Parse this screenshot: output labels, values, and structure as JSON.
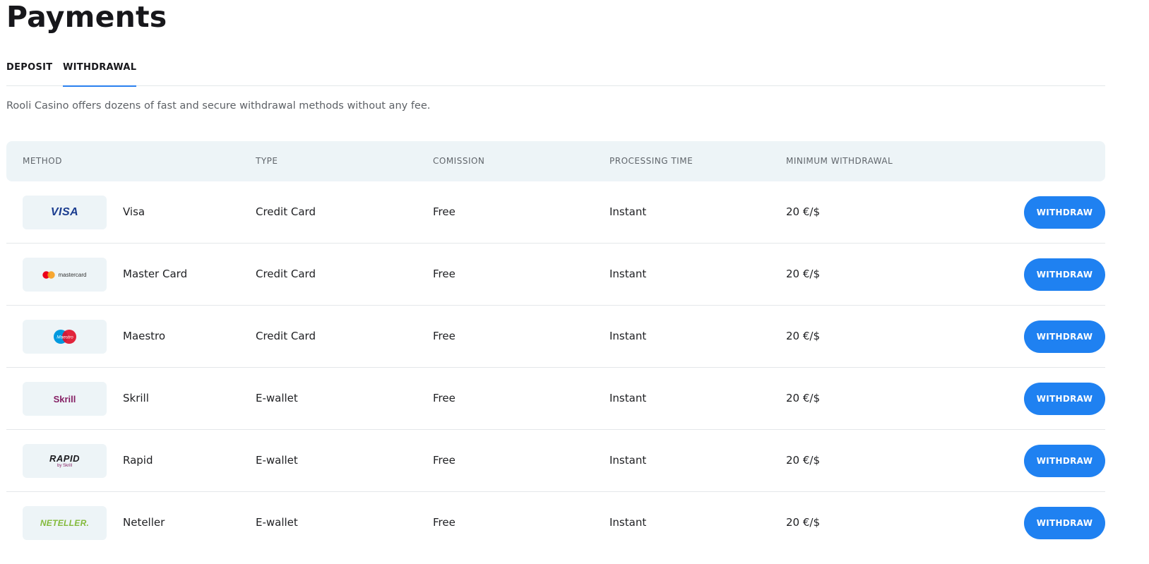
{
  "page": {
    "title": "Payments"
  },
  "tabs": [
    {
      "label": "DEPOSIT",
      "active": false
    },
    {
      "label": "WITHDRAWAL",
      "active": true
    }
  ],
  "intro": "Rooli Casino offers dozens of fast and secure withdrawal methods without any fee.",
  "table": {
    "headers": {
      "method": "METHOD",
      "type": "TYPE",
      "commission": "COMISSION",
      "processing_time": "PROCESSING TIME",
      "minimum_withdrawal": "MINIMUM WITHDRAWAL"
    },
    "button_label": "WITHDRAW",
    "rows": [
      {
        "logo_text": "VISA",
        "logo_icon": "visa-logo-icon",
        "name": "Visa",
        "type": "Credit Card",
        "commission": "Free",
        "processing_time": "Instant",
        "minimum": "20 €/$"
      },
      {
        "logo_text": "mastercard",
        "logo_icon": "mastercard-logo-icon",
        "name": "Master Card",
        "type": "Credit Card",
        "commission": "Free",
        "processing_time": "Instant",
        "minimum": "20 €/$"
      },
      {
        "logo_text": "Maestro",
        "logo_icon": "maestro-logo-icon",
        "name": "Maestro",
        "type": "Credit Card",
        "commission": "Free",
        "processing_time": "Instant",
        "minimum": "20 €/$"
      },
      {
        "logo_text": "Skrill",
        "logo_icon": "skrill-logo-icon",
        "name": "Skrill",
        "type": "E-wallet",
        "commission": "Free",
        "processing_time": "Instant",
        "minimum": "20 €/$"
      },
      {
        "logo_text": "RAPID",
        "logo_subtext": "by Skrill",
        "logo_icon": "rapid-logo-icon",
        "name": "Rapid",
        "type": "E-wallet",
        "commission": "Free",
        "processing_time": "Instant",
        "minimum": "20 €/$"
      },
      {
        "logo_text": "NETELLER.",
        "logo_icon": "neteller-logo-icon",
        "name": "Neteller",
        "type": "E-wallet",
        "commission": "Free",
        "processing_time": "Instant",
        "minimum": "20 €/$"
      }
    ]
  },
  "colors": {
    "accent": "#1f81f1",
    "header_bg": "#edf4f7",
    "visa": "#1a3c8f",
    "mastercard_red": "#eb001b",
    "mastercard_orange": "#f79e1b",
    "maestro_blue": "#0099df",
    "maestro_red": "#e0112a",
    "skrill": "#862165",
    "neteller": "#83ba3b"
  }
}
